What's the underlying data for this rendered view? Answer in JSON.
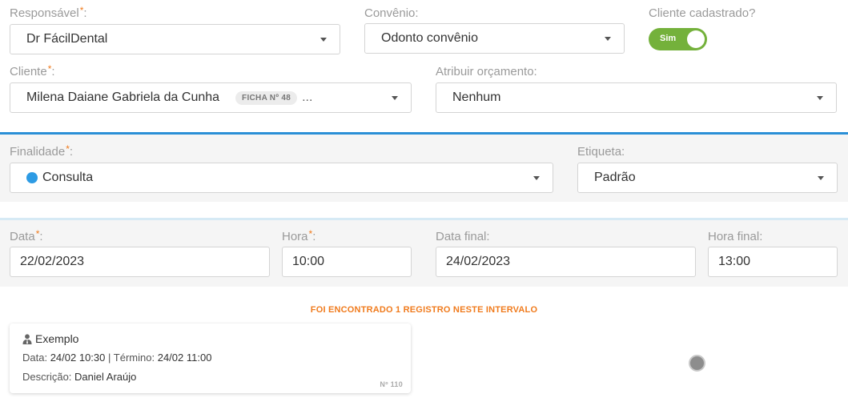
{
  "responsavel": {
    "label": "Responsável",
    "required": "*",
    "suffix": ":",
    "value": "Dr FácilDental"
  },
  "convenio": {
    "label": "Convênio:",
    "value": "Odonto convênio"
  },
  "cliente_cadastrado": {
    "label": "Cliente cadastrado?",
    "toggle_label": "Sim",
    "checked": true
  },
  "cliente": {
    "label": "Cliente",
    "required": "*",
    "suffix": ":",
    "value": "Milena Daiane Gabriela da Cunha",
    "badge": "FICHA Nº 48",
    "ellipsis": "..."
  },
  "atribuir_orcamento": {
    "label": "Atribuir orçamento:",
    "value": "Nenhum"
  },
  "finalidade": {
    "label": "Finalidade",
    "required": "*",
    "suffix": ":",
    "value": "Consulta",
    "dot_color": "#2d9be4"
  },
  "etiqueta": {
    "label": "Etiqueta:",
    "value": "Padrão"
  },
  "data": {
    "label": "Data",
    "required": "*",
    "suffix": ":",
    "value": "22/02/2023"
  },
  "hora": {
    "label": "Hora",
    "required": "*",
    "suffix": ":",
    "value": "10:00"
  },
  "data_final": {
    "label": "Data final:",
    "value": "24/02/2023"
  },
  "hora_final": {
    "label": "Hora final:",
    "value": "13:00"
  },
  "notice": "FOI ENCONTRADO 1 REGISTRO NESTE INTERVALO",
  "record": {
    "icon": "user-tie-icon",
    "title": "Exemplo",
    "data_label": "Data:",
    "data_value": "24/02 10:30",
    "separator": "|",
    "termino_label": "Término:",
    "termino_value": "24/02 11:00",
    "descricao_label": "Descrição:",
    "descricao_value": "Daniel Araújo",
    "number": "Nº 110"
  },
  "colors": {
    "accent": "#2a8fd6",
    "warning": "#f07b1d",
    "toggle_on": "#74b13b"
  }
}
